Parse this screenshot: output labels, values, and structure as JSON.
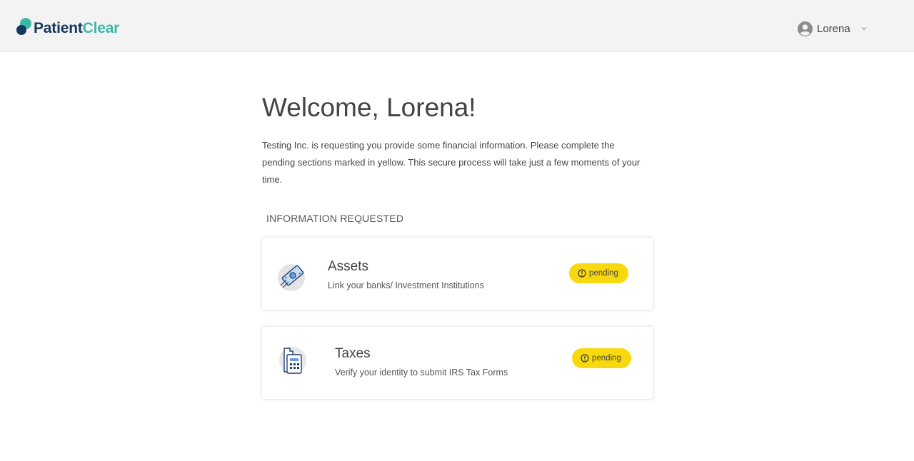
{
  "header": {
    "logo": {
      "part1": "Patient",
      "part2": "Clear"
    },
    "user": {
      "name": "Lorena",
      "avatar_icon": "user-circle-icon",
      "menu_icon": "chevron-down-icon"
    }
  },
  "main": {
    "welcome": "Welcome, Lorena!",
    "intro": "Testing Inc. is requesting you provide some financial information. Please complete the pending sections marked in yellow. This secure process will take just a few moments of your time.",
    "section_label": "INFORMATION REQUESTED",
    "cards": [
      {
        "icon": "money-bill-icon",
        "title": "Assets",
        "subtitle": "Link your banks/ Investment  Institutions",
        "status": "pending"
      },
      {
        "icon": "tax-forms-icon",
        "title": "Taxes",
        "subtitle": "Verify your identity to submit IRS Tax Forms",
        "status": "pending"
      }
    ]
  },
  "colors": {
    "brand_navy": "#17375e",
    "brand_teal": "#3fb6a8",
    "pending_yellow": "#f8d80e",
    "topbar_bg": "#f3f3f3"
  }
}
